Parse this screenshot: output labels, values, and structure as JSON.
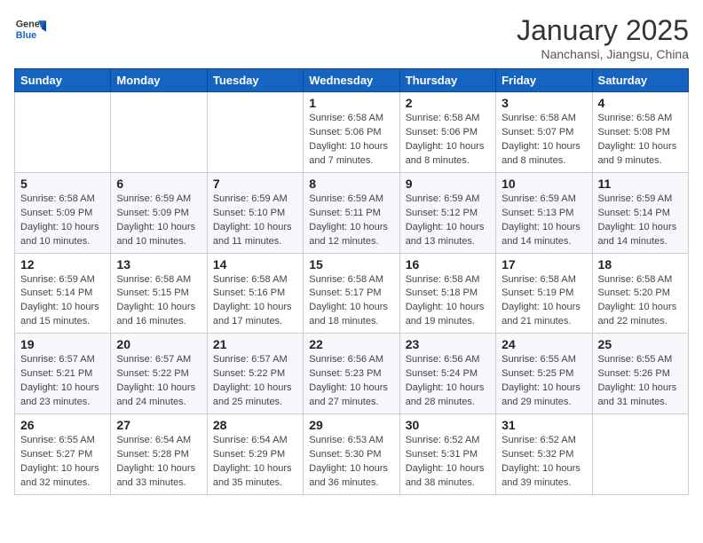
{
  "header": {
    "logo_general": "General",
    "logo_blue": "Blue",
    "month_title": "January 2025",
    "subtitle": "Nanchansi, Jiangsu, China"
  },
  "weekdays": [
    "Sunday",
    "Monday",
    "Tuesday",
    "Wednesday",
    "Thursday",
    "Friday",
    "Saturday"
  ],
  "weeks": [
    [
      {
        "day": "",
        "info": ""
      },
      {
        "day": "",
        "info": ""
      },
      {
        "day": "",
        "info": ""
      },
      {
        "day": "1",
        "info": "Sunrise: 6:58 AM\nSunset: 5:06 PM\nDaylight: 10 hours\nand 7 minutes."
      },
      {
        "day": "2",
        "info": "Sunrise: 6:58 AM\nSunset: 5:06 PM\nDaylight: 10 hours\nand 8 minutes."
      },
      {
        "day": "3",
        "info": "Sunrise: 6:58 AM\nSunset: 5:07 PM\nDaylight: 10 hours\nand 8 minutes."
      },
      {
        "day": "4",
        "info": "Sunrise: 6:58 AM\nSunset: 5:08 PM\nDaylight: 10 hours\nand 9 minutes."
      }
    ],
    [
      {
        "day": "5",
        "info": "Sunrise: 6:58 AM\nSunset: 5:09 PM\nDaylight: 10 hours\nand 10 minutes."
      },
      {
        "day": "6",
        "info": "Sunrise: 6:59 AM\nSunset: 5:09 PM\nDaylight: 10 hours\nand 10 minutes."
      },
      {
        "day": "7",
        "info": "Sunrise: 6:59 AM\nSunset: 5:10 PM\nDaylight: 10 hours\nand 11 minutes."
      },
      {
        "day": "8",
        "info": "Sunrise: 6:59 AM\nSunset: 5:11 PM\nDaylight: 10 hours\nand 12 minutes."
      },
      {
        "day": "9",
        "info": "Sunrise: 6:59 AM\nSunset: 5:12 PM\nDaylight: 10 hours\nand 13 minutes."
      },
      {
        "day": "10",
        "info": "Sunrise: 6:59 AM\nSunset: 5:13 PM\nDaylight: 10 hours\nand 14 minutes."
      },
      {
        "day": "11",
        "info": "Sunrise: 6:59 AM\nSunset: 5:14 PM\nDaylight: 10 hours\nand 14 minutes."
      }
    ],
    [
      {
        "day": "12",
        "info": "Sunrise: 6:59 AM\nSunset: 5:14 PM\nDaylight: 10 hours\nand 15 minutes."
      },
      {
        "day": "13",
        "info": "Sunrise: 6:58 AM\nSunset: 5:15 PM\nDaylight: 10 hours\nand 16 minutes."
      },
      {
        "day": "14",
        "info": "Sunrise: 6:58 AM\nSunset: 5:16 PM\nDaylight: 10 hours\nand 17 minutes."
      },
      {
        "day": "15",
        "info": "Sunrise: 6:58 AM\nSunset: 5:17 PM\nDaylight: 10 hours\nand 18 minutes."
      },
      {
        "day": "16",
        "info": "Sunrise: 6:58 AM\nSunset: 5:18 PM\nDaylight: 10 hours\nand 19 minutes."
      },
      {
        "day": "17",
        "info": "Sunrise: 6:58 AM\nSunset: 5:19 PM\nDaylight: 10 hours\nand 21 minutes."
      },
      {
        "day": "18",
        "info": "Sunrise: 6:58 AM\nSunset: 5:20 PM\nDaylight: 10 hours\nand 22 minutes."
      }
    ],
    [
      {
        "day": "19",
        "info": "Sunrise: 6:57 AM\nSunset: 5:21 PM\nDaylight: 10 hours\nand 23 minutes."
      },
      {
        "day": "20",
        "info": "Sunrise: 6:57 AM\nSunset: 5:22 PM\nDaylight: 10 hours\nand 24 minutes."
      },
      {
        "day": "21",
        "info": "Sunrise: 6:57 AM\nSunset: 5:22 PM\nDaylight: 10 hours\nand 25 minutes."
      },
      {
        "day": "22",
        "info": "Sunrise: 6:56 AM\nSunset: 5:23 PM\nDaylight: 10 hours\nand 27 minutes."
      },
      {
        "day": "23",
        "info": "Sunrise: 6:56 AM\nSunset: 5:24 PM\nDaylight: 10 hours\nand 28 minutes."
      },
      {
        "day": "24",
        "info": "Sunrise: 6:55 AM\nSunset: 5:25 PM\nDaylight: 10 hours\nand 29 minutes."
      },
      {
        "day": "25",
        "info": "Sunrise: 6:55 AM\nSunset: 5:26 PM\nDaylight: 10 hours\nand 31 minutes."
      }
    ],
    [
      {
        "day": "26",
        "info": "Sunrise: 6:55 AM\nSunset: 5:27 PM\nDaylight: 10 hours\nand 32 minutes."
      },
      {
        "day": "27",
        "info": "Sunrise: 6:54 AM\nSunset: 5:28 PM\nDaylight: 10 hours\nand 33 minutes."
      },
      {
        "day": "28",
        "info": "Sunrise: 6:54 AM\nSunset: 5:29 PM\nDaylight: 10 hours\nand 35 minutes."
      },
      {
        "day": "29",
        "info": "Sunrise: 6:53 AM\nSunset: 5:30 PM\nDaylight: 10 hours\nand 36 minutes."
      },
      {
        "day": "30",
        "info": "Sunrise: 6:52 AM\nSunset: 5:31 PM\nDaylight: 10 hours\nand 38 minutes."
      },
      {
        "day": "31",
        "info": "Sunrise: 6:52 AM\nSunset: 5:32 PM\nDaylight: 10 hours\nand 39 minutes."
      },
      {
        "day": "",
        "info": ""
      }
    ]
  ]
}
